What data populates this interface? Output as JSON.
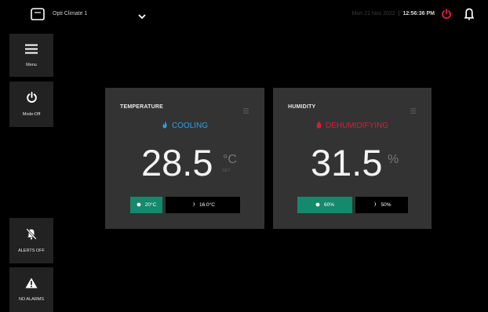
{
  "header": {
    "device_name": "Opti Climate 1",
    "date": "Mon 21 Nov 2022",
    "separator": "|",
    "time": "12:56:36 PM"
  },
  "sidebar": {
    "menu_label": "Menu",
    "mode_label": "Mode:Off",
    "alerts_label": "ALERTS OFF",
    "alarms_label": "NO ALARMS"
  },
  "temperature": {
    "title": "TEMPERATURE",
    "status": "COOLING",
    "value": "28.5",
    "unit": "°C",
    "unit_sub": "SET",
    "day_setpoint": "20°C",
    "night_setpoint": "16.0°C"
  },
  "humidity": {
    "title": "HUMIDITY",
    "status": "DEHUMIDIFYING",
    "value": "31.5",
    "unit": "%",
    "day_setpoint": "60%",
    "night_setpoint": "50%"
  },
  "colors": {
    "background": "#000000",
    "card": "#333333",
    "sidebar_button": "#222222",
    "cooling": "#2e9fe2",
    "dehumidifying": "#d81b3a",
    "day_setpoint": "#14896c",
    "power_icon": "#e0223b"
  },
  "icons": {
    "device": "device-icon",
    "chevron": "chevron-down-icon",
    "power": "power-icon",
    "alert": "alert-bell-icon",
    "menu": "menu-icon",
    "mode": "power-mode-icon",
    "alerts_off": "bell-off-icon",
    "alarms": "warning-icon",
    "cooling": "fire-icon",
    "dehumidifying": "drop-icon",
    "day": "sun-icon",
    "night": "moon-icon"
  }
}
